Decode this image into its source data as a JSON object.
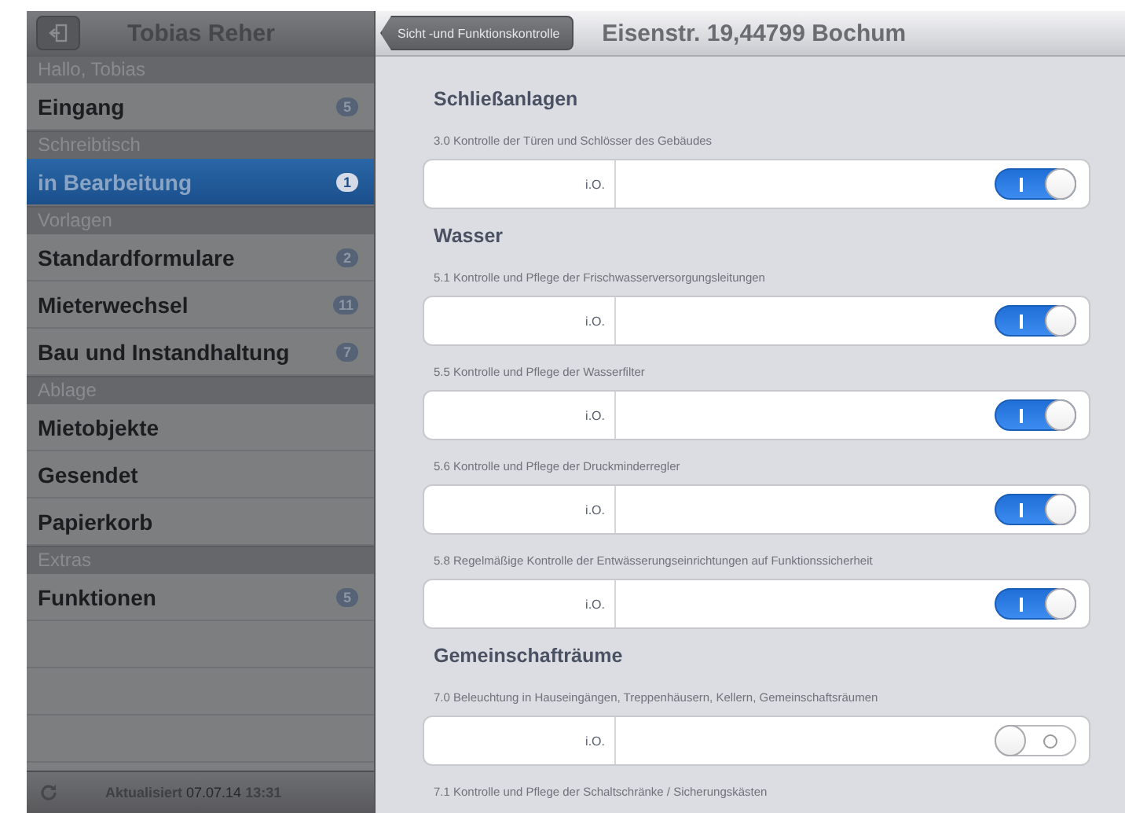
{
  "sidebar": {
    "title": "Tobias Reher",
    "sections": [
      {
        "header": "Hallo, Tobias",
        "items": [
          {
            "label": "Eingang",
            "badge": "5",
            "selected": false
          }
        ]
      },
      {
        "header": "Schreibtisch",
        "items": [
          {
            "label": "in Bearbeitung",
            "badge": "1",
            "selected": true
          }
        ]
      },
      {
        "header": "Vorlagen",
        "items": [
          {
            "label": "Standardformulare",
            "badge": "2",
            "selected": false
          },
          {
            "label": "Mieterwechsel",
            "badge": "11",
            "selected": false
          },
          {
            "label": "Bau und Instandhaltung",
            "badge": "7",
            "selected": false
          }
        ]
      },
      {
        "header": "Ablage",
        "items": [
          {
            "label": "Mietobjekte",
            "selected": false
          },
          {
            "label": "Gesendet",
            "selected": false
          },
          {
            "label": "Papierkorb",
            "selected": false
          }
        ]
      },
      {
        "header": "Extras",
        "items": [
          {
            "label": "Funktionen",
            "badge": "5",
            "selected": false
          }
        ]
      }
    ],
    "footer": {
      "label": "Aktualisiert",
      "date": "07.07.14",
      "time": "13:31"
    }
  },
  "main": {
    "back_button": "Sicht -und Funktionskontrolle",
    "title": "Eisenstr. 19,44799 Bochum",
    "sections": [
      {
        "title": "Schließanlagen",
        "items": [
          {
            "label": "3.0 Kontrolle der Türen und Schlösser des Gebäudes",
            "field": "i.O.",
            "on": true
          }
        ]
      },
      {
        "title": "Wasser",
        "items": [
          {
            "label": "5.1 Kontrolle und Pflege der Frischwasserversorgungsleitungen",
            "field": "i.O.",
            "on": true
          },
          {
            "label": "5.5 Kontrolle und Pflege der Wasserfilter",
            "field": "i.O.",
            "on": true
          },
          {
            "label": "5.6 Kontrolle und Pflege der Druckminderregler",
            "field": "i.O.",
            "on": true
          },
          {
            "label": "5.8 Regelmäßige Kontrolle der Entwässerungseinrichtungen auf Funktionssicherheit",
            "field": "i.O.",
            "on": true
          }
        ]
      },
      {
        "title": "Gemeinschafträume",
        "items": [
          {
            "label": "7.0 Beleuchtung in Hauseingängen, Treppenhäusern, Kellern, Gemeinschaftsräumen",
            "field": "i.O.",
            "on": false
          },
          {
            "label": "7.1 Kontrolle und Pflege der Schaltschränke / Sicherungskästen"
          }
        ]
      }
    ]
  }
}
